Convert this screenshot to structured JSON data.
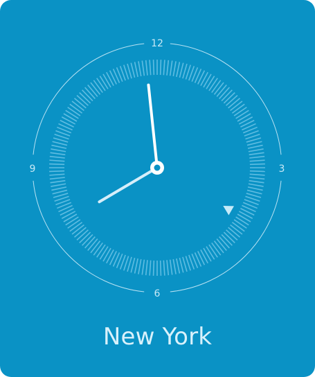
{
  "clock": {
    "city": "New York",
    "numerals": {
      "twelve": "12",
      "three": "3",
      "six": "6",
      "nine": "9"
    },
    "time": {
      "hour": 7,
      "minute": 59
    },
    "marker_angle_deg": 120
  },
  "colors": {
    "background": "#0a92c5",
    "hands": "#ffffff",
    "hour_hand": "#d6eefa",
    "ticks": "#5fbde2",
    "ring": "#b9e2f3",
    "marker": "#c6ebf9"
  }
}
